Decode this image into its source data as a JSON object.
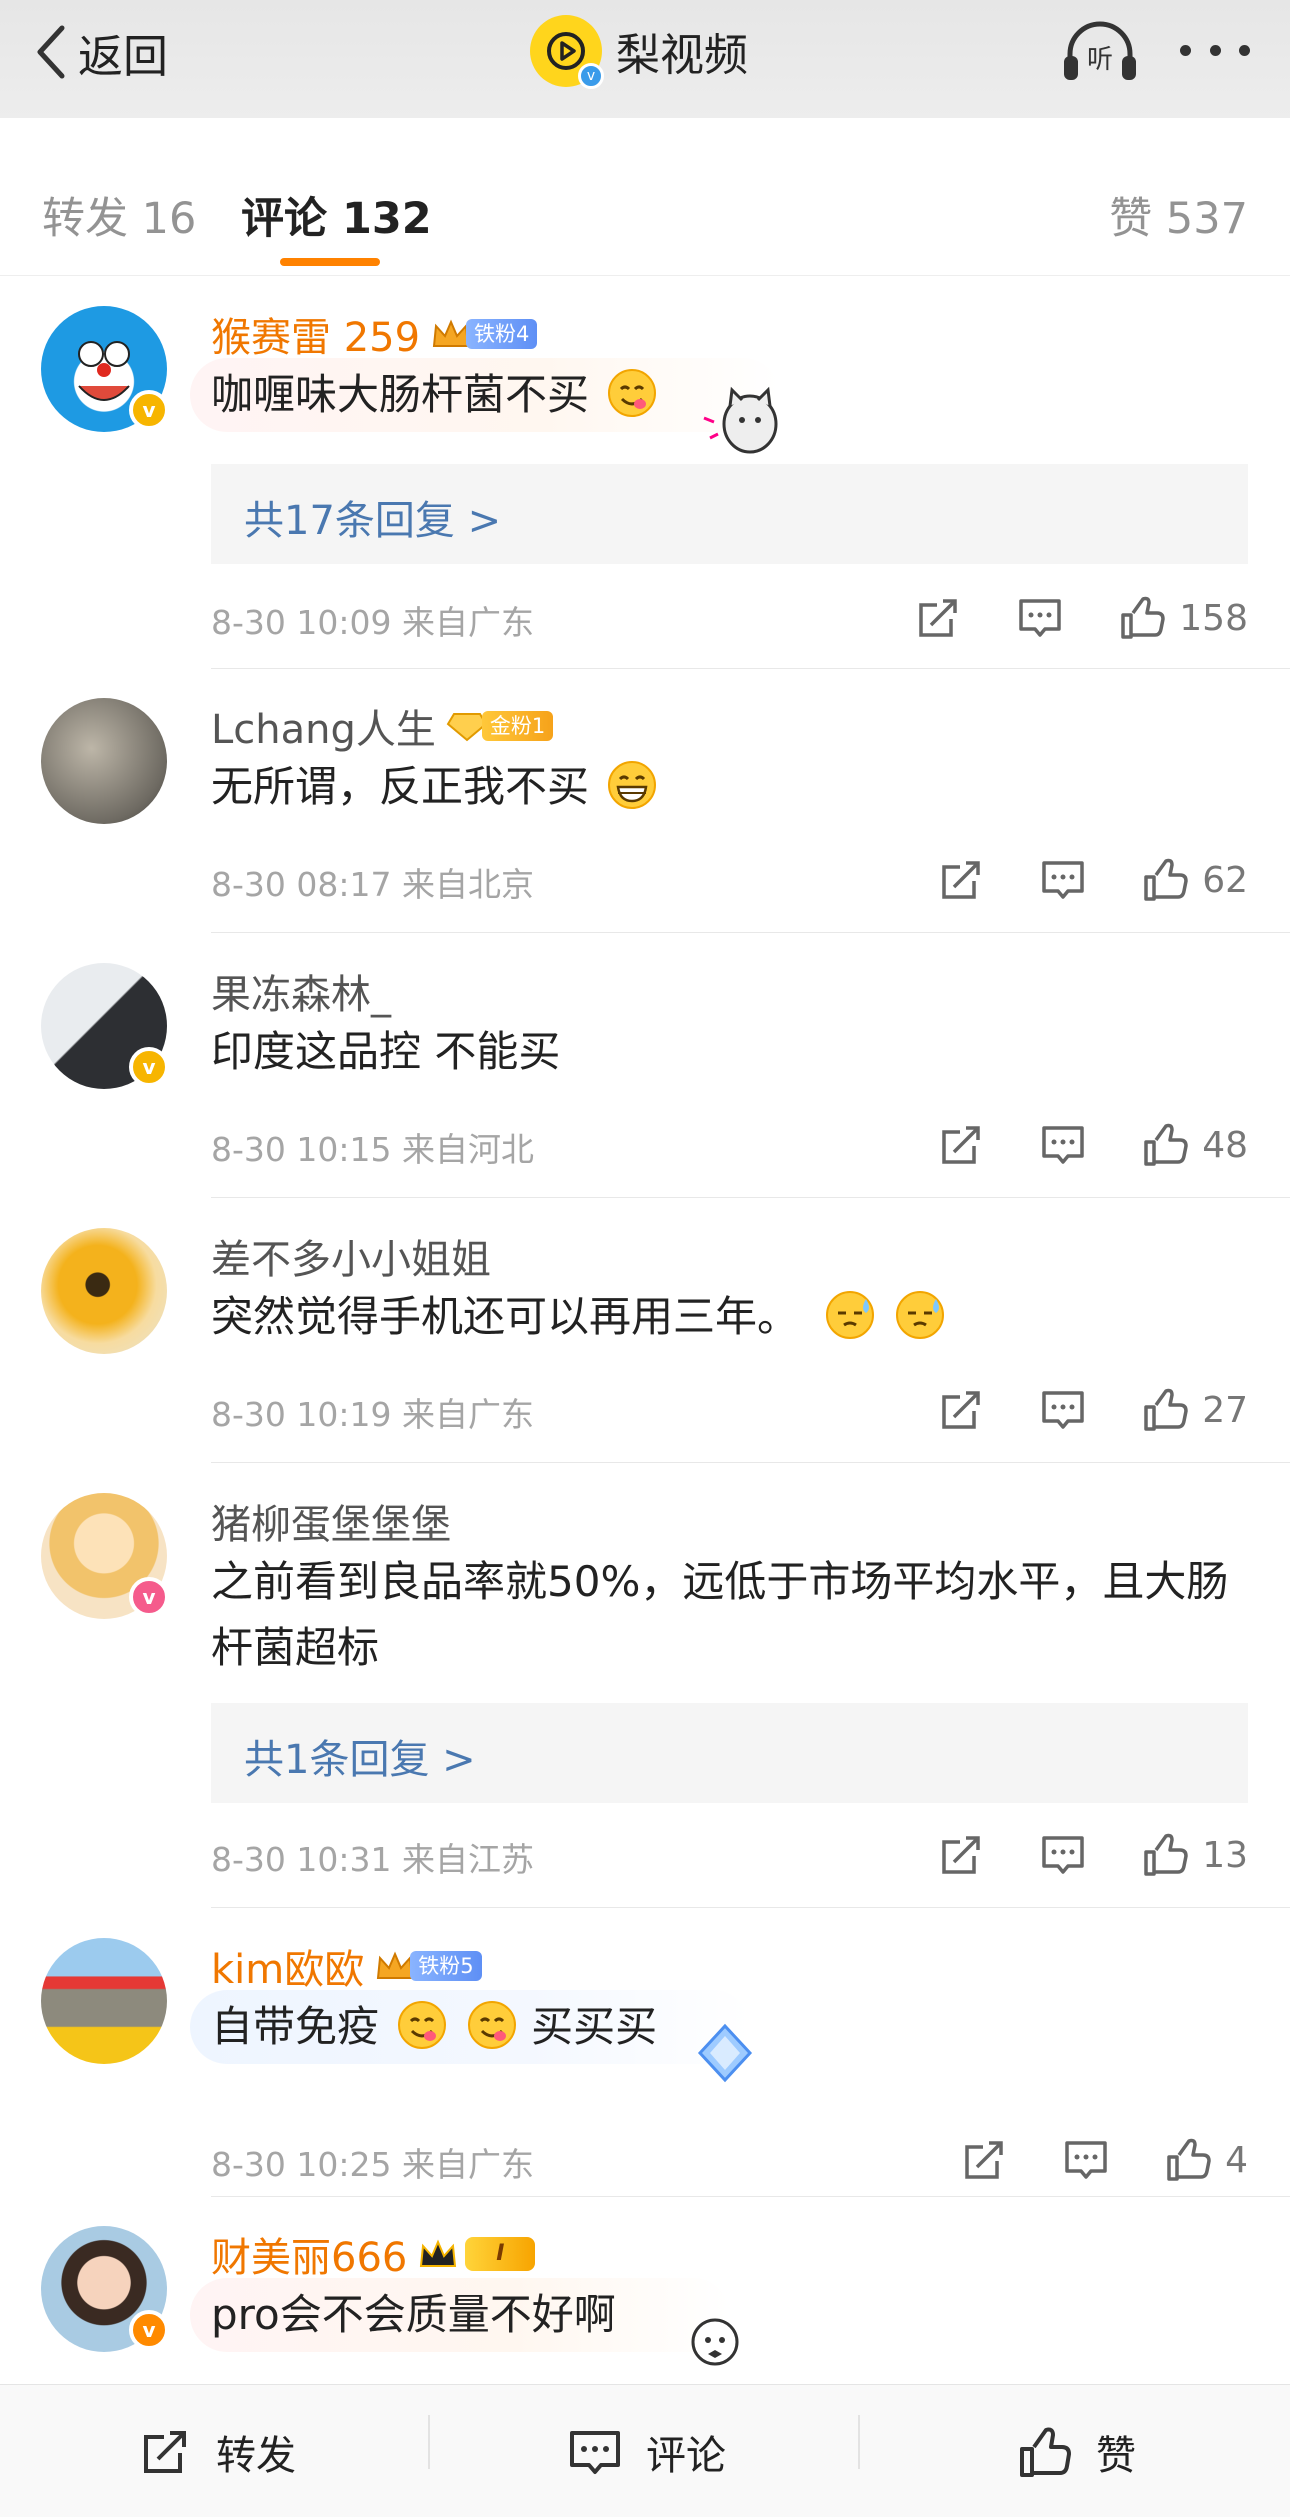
{
  "nav": {
    "back_label": "返回",
    "channel_name": "梨视频",
    "listen_label": "听"
  },
  "tabs": {
    "repost": "转发 16",
    "comments": "评论 132",
    "likes": "赞 537"
  },
  "comments": [
    {
      "user": "猴赛雷 259",
      "fan_tag": "铁粉4",
      "text": "咖喱味大肠杆菌不买",
      "replies": "共17条回复 >",
      "meta": "8-30 10:09  来自广东",
      "likes": "158"
    },
    {
      "user": "Lchang人生",
      "fan_tag": "金粉1",
      "text": "无所谓，反正我不买",
      "meta": "8-30 08:17  来自北京",
      "likes": "62"
    },
    {
      "user": "果冻森林_",
      "text": "印度这品控 不能买",
      "meta": "8-30 10:15  来自河北",
      "likes": "48"
    },
    {
      "user": "差不多小小姐姐",
      "text": "突然觉得手机还可以再用三年。",
      "meta": "8-30 10:19  来自广东",
      "likes": "27"
    },
    {
      "user": "猪柳蛋堡堡堡",
      "text": "之前看到良品率就50%，远低于市场平均水平，且大肠杆菌超标",
      "replies": "共1条回复 >",
      "meta": "8-30 10:31  来自江苏",
      "likes": "13"
    },
    {
      "user": "kim欧欧",
      "fan_tag": "铁粉5",
      "text_a": "自带免疫",
      "text_b": "买买买",
      "meta": "8-30 10:25  来自广东",
      "likes": "4"
    },
    {
      "user": "财美丽666",
      "vip_tag": "I",
      "text": "pro会不会质量不好啊"
    }
  ],
  "toolbar": {
    "repost": "转发",
    "comment": "评论",
    "like": "赞"
  },
  "colors": {
    "accent": "#ff8200",
    "vip_name": "#f07700",
    "reply_link": "#4a78b0"
  }
}
